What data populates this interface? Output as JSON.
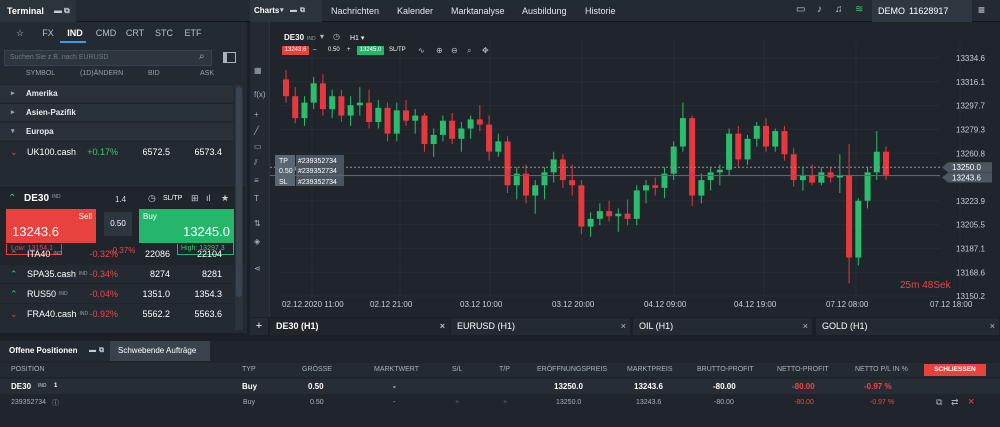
{
  "topbar": {
    "terminal_label": "Terminal",
    "charts_label": "Charts",
    "nav": [
      "Nachrichten",
      "Kalender",
      "Marktanalyse",
      "Ausbildung",
      "Historie"
    ],
    "account_mode": "DEMO",
    "account_id": "11628917"
  },
  "terminal": {
    "categories": [
      "☆",
      "FX",
      "IND",
      "CMD",
      "CRT",
      "STC",
      "ETF"
    ],
    "active_category": "IND",
    "search_placeholder": "Suchen Sie z.B. nach EURUSD",
    "columns": {
      "symbol": "SYMBOL",
      "change": "(1D)ÄNDERN",
      "bid": "BID",
      "ask": "ASK"
    },
    "groups": [
      "Amerika",
      "Asien-Pazifik",
      "Europa"
    ],
    "rows": [
      {
        "name": "UK100.cash",
        "tag": "",
        "change": "+0.17%",
        "bid": "6572.5",
        "ask": "6573.4"
      },
      {
        "name": "ITA40",
        "tag": "IND",
        "change": "-0.32%",
        "bid": "22086",
        "ask": "22104"
      },
      {
        "name": "SPA35.cash",
        "tag": "IND",
        "change": "-0.34%",
        "bid": "8274",
        "ask": "8281"
      },
      {
        "name": "RUS50",
        "tag": "IND",
        "change": "-0.04%",
        "bid": "1351.0",
        "ask": "1354.3"
      },
      {
        "name": "FRA40.cash",
        "tag": "IND",
        "change": "-0.92%",
        "bid": "5562.2",
        "ask": "5563.6"
      }
    ],
    "panel": {
      "symbol": "DE30",
      "tag": "IND",
      "lot": "1.4",
      "sltp": "SL/TP",
      "sell_label": "Sell",
      "sell_price": "13243.6",
      "buy_label": "Buy",
      "buy_price": "13245.0",
      "spread": "0.50",
      "low": "Low: 13154.1",
      "high": "High: 13297.3",
      "change": "-0.37%"
    }
  },
  "chart": {
    "symbol": "DE30",
    "tag": "IND",
    "timeframe": "H1",
    "sell": "13243.6",
    "spread": "0.50",
    "buy": "13245.0",
    "sltp": "SL/TP",
    "tp_label": "TP",
    "tp_id": "#239352734",
    "pos_lot": "0.50",
    "pos_id": "#239352734",
    "sl_label": "SL",
    "sl_id": "#239352734",
    "countdown": "25m 48Sek",
    "tabs": [
      "DE30 (H1)",
      "EURUSD (H1)",
      "OIL (H1)",
      "GOLD (H1)"
    ]
  },
  "chart_data": {
    "type": "candlestick",
    "y_ticks": [
      "13334.6",
      "13316.1",
      "13297.7",
      "13279.3",
      "13260.8",
      "13242.4",
      "13223.9",
      "13205.5",
      "13187.1",
      "13168.6",
      "13150.2"
    ],
    "x_ticks": [
      "02.12.2020 11:00",
      "02.12 21:00",
      "03.12 10:00",
      "03.12 20:00",
      "04.12 09:00",
      "04.12 19:00",
      "07.12 08:00",
      "07.12 18:00"
    ],
    "price_markers": {
      "line": "13250.0",
      "current": "13243.6"
    },
    "colors": {
      "up": "#2bbd6b",
      "down": "#e5393f"
    },
    "candles": [
      [
        13318,
        13325,
        13300,
        13305
      ],
      [
        13305,
        13312,
        13284,
        13288
      ],
      [
        13288,
        13305,
        13282,
        13300
      ],
      [
        13300,
        13320,
        13295,
        13315
      ],
      [
        13315,
        13322,
        13290,
        13295
      ],
      [
        13295,
        13310,
        13288,
        13305
      ],
      [
        13305,
        13310,
        13285,
        13290
      ],
      [
        13290,
        13305,
        13282,
        13298
      ],
      [
        13298,
        13312,
        13290,
        13300
      ],
      [
        13300,
        13310,
        13280,
        13285
      ],
      [
        13285,
        13302,
        13280,
        13296
      ],
      [
        13296,
        13300,
        13270,
        13276
      ],
      [
        13276,
        13300,
        13270,
        13294
      ],
      [
        13294,
        13302,
        13282,
        13286
      ],
      [
        13286,
        13295,
        13276,
        13290
      ],
      [
        13290,
        13292,
        13262,
        13268
      ],
      [
        13268,
        13280,
        13258,
        13275
      ],
      [
        13275,
        13290,
        13270,
        13286
      ],
      [
        13286,
        13292,
        13268,
        13272
      ],
      [
        13272,
        13285,
        13262,
        13280
      ],
      [
        13280,
        13290,
        13272,
        13287
      ],
      [
        13287,
        13298,
        13278,
        13283
      ],
      [
        13283,
        13290,
        13255,
        13262
      ],
      [
        13262,
        13276,
        13258,
        13270
      ],
      [
        13270,
        13274,
        13230,
        13236
      ],
      [
        13236,
        13250,
        13225,
        13245
      ],
      [
        13245,
        13252,
        13222,
        13228
      ],
      [
        13228,
        13240,
        13214,
        13236
      ],
      [
        13236,
        13250,
        13225,
        13246
      ],
      [
        13246,
        13262,
        13238,
        13256
      ],
      [
        13256,
        13260,
        13234,
        13240
      ],
      [
        13240,
        13252,
        13228,
        13236
      ],
      [
        13236,
        13240,
        13198,
        13204
      ],
      [
        13204,
        13215,
        13196,
        13210
      ],
      [
        13210,
        13222,
        13205,
        13216
      ],
      [
        13216,
        13224,
        13208,
        13212
      ],
      [
        13212,
        13218,
        13200,
        13214
      ],
      [
        13214,
        13225,
        13205,
        13210
      ],
      [
        13210,
        13236,
        13205,
        13232
      ],
      [
        13232,
        13240,
        13222,
        13236
      ],
      [
        13236,
        13242,
        13228,
        13234
      ],
      [
        13234,
        13250,
        13226,
        13245
      ],
      [
        13245,
        13270,
        13240,
        13266
      ],
      [
        13266,
        13300,
        13262,
        13288
      ],
      [
        13288,
        13290,
        13220,
        13228
      ],
      [
        13228,
        13245,
        13222,
        13240
      ],
      [
        13240,
        13250,
        13232,
        13246
      ],
      [
        13246,
        13252,
        13236,
        13248
      ],
      [
        13248,
        13280,
        13244,
        13276
      ],
      [
        13276,
        13282,
        13250,
        13256
      ],
      [
        13256,
        13275,
        13252,
        13272
      ],
      [
        13272,
        13285,
        13266,
        13282
      ],
      [
        13282,
        13288,
        13262,
        13266
      ],
      [
        13266,
        13280,
        13262,
        13278
      ],
      [
        13278,
        13282,
        13255,
        13260
      ],
      [
        13260,
        13265,
        13235,
        13240
      ],
      [
        13240,
        13250,
        13232,
        13244
      ],
      [
        13244,
        13252,
        13236,
        13238
      ],
      [
        13238,
        13250,
        13236,
        13246
      ],
      [
        13246,
        13250,
        13238,
        13242
      ],
      [
        13242,
        13260,
        13230,
        13244
      ],
      [
        13244,
        13268,
        13160,
        13180
      ],
      [
        13180,
        13226,
        13174,
        13224
      ],
      [
        13224,
        13250,
        13218,
        13246
      ],
      [
        13246,
        13278,
        13240,
        13262
      ],
      [
        13262,
        13266,
        13240,
        13244
      ]
    ]
  },
  "positions": {
    "tab_open": "Offene Positionen",
    "tab_pending": "Schwebende Aufträge",
    "close_all": "SCHLIESSEN",
    "headers": [
      "POSITION",
      "TYP",
      "GRÖSSE",
      "MARKTWERT",
      "S/L",
      "T/P",
      "ERÖFFNUNGSPREIS",
      "MARKTPREIS",
      "BRUTTO-PROFIT",
      "NETTO-PROFIT",
      "NETTO P/L IN %"
    ],
    "group_row": {
      "symbol": "DE30",
      "tag": "IND",
      "count": "1",
      "type": "Buy",
      "size": "0.50",
      "market_value": "-",
      "open": "13250.0",
      "market": "13243.6",
      "gross": "-80.00",
      "net": "-80.00",
      "pct": "-0.97 %"
    },
    "detail_row": {
      "id": "239352734",
      "type": "Buy",
      "size": "0.50",
      "market_value": "-",
      "sl": "+",
      "tp": "+",
      "open": "13250.0",
      "market": "13243.6",
      "gross": "-80.00",
      "net": "-80.00",
      "pct": "-0.97 %"
    }
  }
}
